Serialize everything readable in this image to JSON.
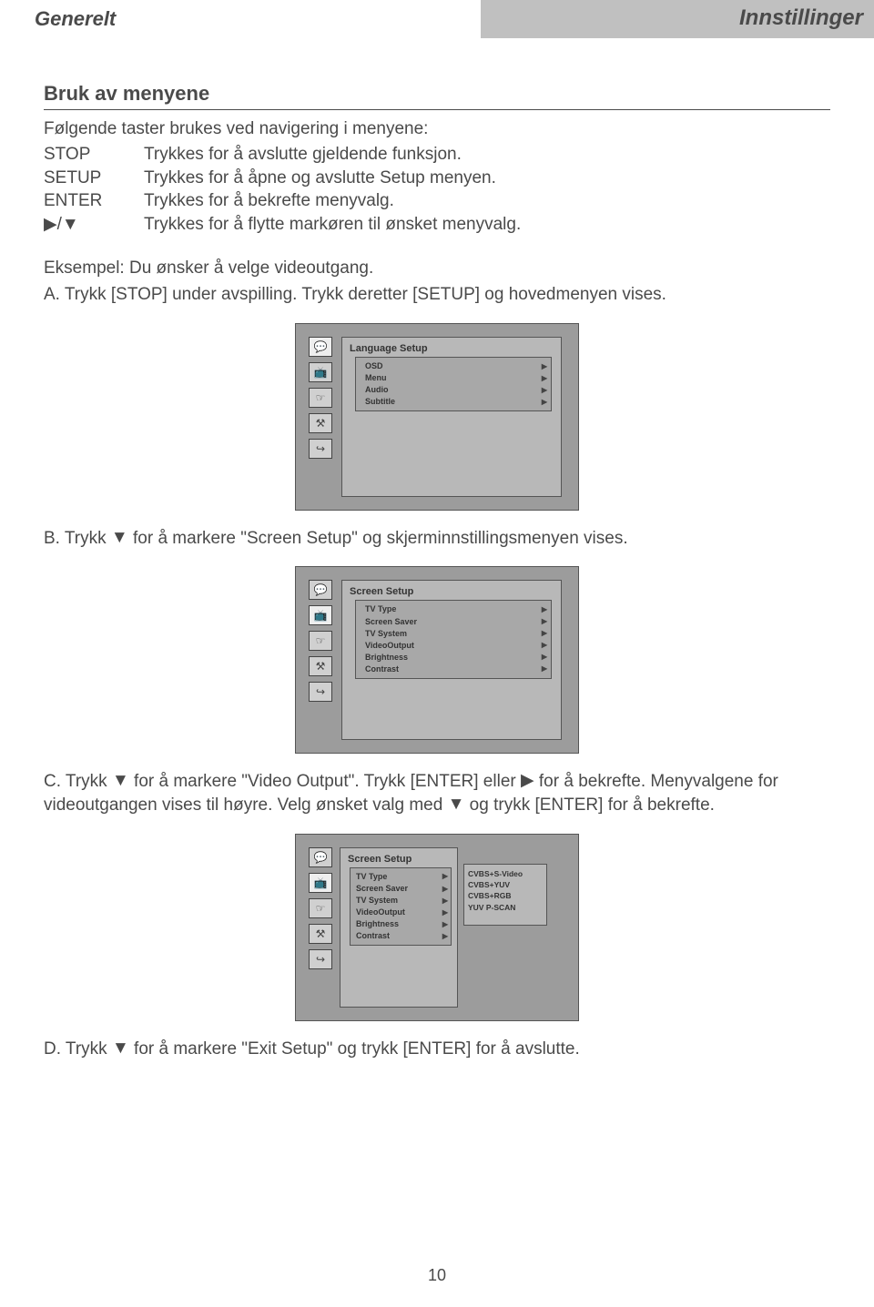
{
  "header": {
    "left": "Generelt",
    "right": "Innstillinger"
  },
  "section_title": "Bruk av menyene",
  "intro": "Følgende taster brukes ved navigering i menyene:",
  "keys": [
    {
      "name": "STOP",
      "desc": "Trykkes for å avslutte gjeldende funksjon."
    },
    {
      "name": "SETUP",
      "desc": "Trykkes for å åpne og avslutte Setup menyen."
    },
    {
      "name": "ENTER",
      "desc": "Trykkes for å bekrefte menyvalg."
    },
    {
      "name": "▶/▼",
      "desc": "Trykkes for å flytte markøren til ønsket menyvalg."
    }
  ],
  "example_line": "Eksempel: Du ønsker å velge videoutgang.",
  "step_a": "A. Trykk [STOP] under avspilling. Trykk deretter [SETUP] og hovedmenyen vises.",
  "menu_a": {
    "title": "Language Setup",
    "items": [
      "OSD",
      "Menu",
      "Audio",
      "Subtitle"
    ]
  },
  "step_b_pre": "B. Trykk ",
  "step_b_arrow": "▼",
  "step_b_post": " for å markere \"Screen Setup\" og skjerminnstillingsmenyen vises.",
  "menu_b": {
    "title": "Screen Setup",
    "items": [
      "TV Type",
      "Screen Saver",
      "TV System",
      "VideoOutput",
      "Brightness",
      "Contrast"
    ]
  },
  "step_c_1": "C. Trykk ",
  "step_c_2": "▼",
  "step_c_3": " for å markere \"Video Output\". Trykk [ENTER] eller ",
  "step_c_4": "▶",
  "step_c_5": " for å bekrefte. Menyvalgene for videoutgangen vises til høyre. Velg ønsket valg med ",
  "step_c_6": "▼",
  "step_c_7": " og trykk [ENTER] for å bekrefte.",
  "menu_c": {
    "title": "Screen Setup",
    "items": [
      "TV Type",
      "Screen Saver",
      "TV System",
      "VideoOutput",
      "Brightness",
      "Contrast"
    ],
    "sub": [
      "CVBS+S-Video",
      "CVBS+YUV",
      "CVBS+RGB",
      "YUV P-SCAN"
    ]
  },
  "step_d_pre": "D. Trykk ",
  "step_d_arrow": "▼",
  "step_d_post": " for å markere \"Exit Setup\" og trykk [ENTER] for å avslutte.",
  "icons": {
    "speech": "💬",
    "tv": "📺",
    "hand": "☞",
    "wrench": "⚒",
    "exit": "↪"
  },
  "page_number": "10"
}
